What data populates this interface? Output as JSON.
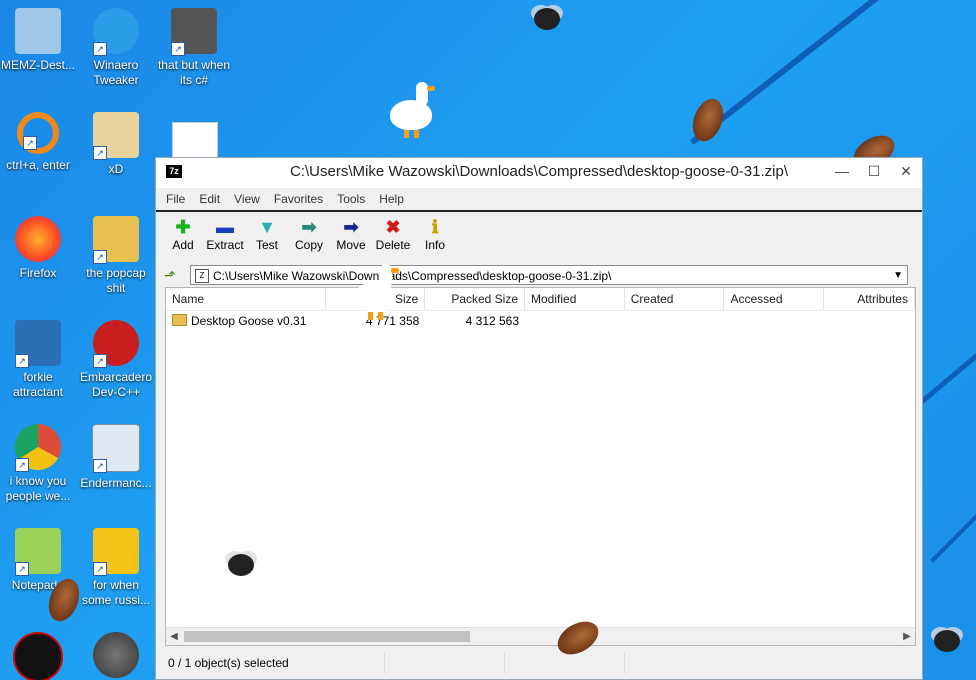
{
  "desktop": {
    "icons": [
      {
        "label": "MEMZ-Dest...",
        "icon": "recycle-bin-icon",
        "color": "#9fc7e8"
      },
      {
        "label": "Winaero Tweaker",
        "icon": "winaero-icon",
        "color": "#2a9de8"
      },
      {
        "label": "that but when its c#",
        "icon": "stack-icon",
        "color": "#555555"
      },
      {
        "label": "ctrl+a, enter",
        "icon": "ring-icon",
        "color": "#f28a1a"
      },
      {
        "label": "xD",
        "icon": "hxd-icon",
        "color": "#e8d49a"
      },
      {
        "label": "Firefox",
        "icon": "firefox-icon",
        "color": "#ff7b22"
      },
      {
        "label": "the popcap shit",
        "icon": "folder-icon",
        "color": "#e8c050"
      },
      {
        "label": "forkie attractant",
        "icon": "monitor-gear-icon",
        "color": "#2b6fb5"
      },
      {
        "label": "Embarcadero Dev-C++",
        "icon": "devcpp-icon",
        "color": "#c81e1e"
      },
      {
        "label": "i know you people we...",
        "icon": "chrome-icon",
        "color": "#dd4b39"
      },
      {
        "label": "Endermanc...",
        "icon": "app-window-icon",
        "color": "#dfe8f0"
      },
      {
        "label": "Notepad+",
        "icon": "notepadpp-icon",
        "color": "#9ad058"
      },
      {
        "label": "for when some russi...",
        "icon": "de-icon",
        "color": "#f2c315"
      }
    ]
  },
  "window": {
    "title": "C:\\Users\\Mike Wazowski\\Downloads\\Compressed\\desktop-goose-0-31.zip\\",
    "app_icon": "7z",
    "menu": [
      "File",
      "Edit",
      "View",
      "Favorites",
      "Tools",
      "Help"
    ],
    "toolbar": [
      {
        "label": "Add",
        "glyph": "✚",
        "color": "#19b31b"
      },
      {
        "label": "Extract",
        "glyph": "▬",
        "color": "#1b3fbf"
      },
      {
        "label": "Test",
        "glyph": "▼",
        "color": "#2ab0b0"
      },
      {
        "label": "Copy",
        "glyph": "➡",
        "color": "#2a8a7a"
      },
      {
        "label": "Move",
        "glyph": "➡",
        "color": "#1a2a8a"
      },
      {
        "label": "Delete",
        "glyph": "✖",
        "color": "#d41b1b"
      },
      {
        "label": "Info",
        "glyph": "ℹ",
        "color": "#c9a000"
      }
    ],
    "address": "C:\\Users\\Mike Wazowski\\Downloads\\Compressed\\desktop-goose-0-31.zip\\",
    "columns": [
      "Name",
      "Size",
      "Packed Size",
      "Modified",
      "Created",
      "Accessed",
      "Attributes"
    ],
    "rows": [
      {
        "name": "Desktop Goose v0.31",
        "size": "4 771 358",
        "packed": "4 312 563",
        "modified": "",
        "created": "",
        "accessed": "",
        "attributes": ""
      }
    ],
    "status": "0 / 1 object(s) selected"
  }
}
